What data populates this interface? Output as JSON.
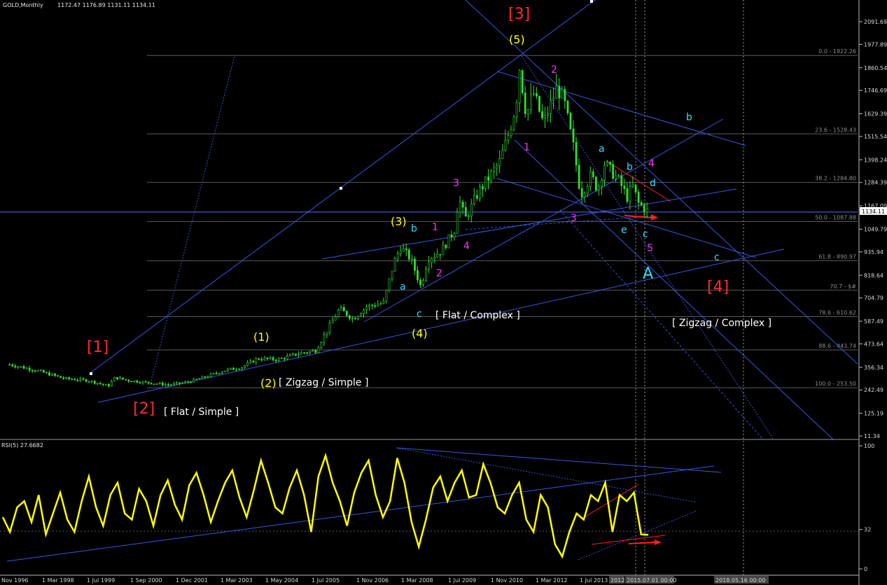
{
  "header": {
    "symbol": "GOLD,Monthly",
    "ohlc": "1172.47 1176.89 1131.11 1134.11"
  },
  "chart_data": [
    {
      "type": "candlestick",
      "title": "GOLD,Monthly",
      "ylim": [
        11.34,
        2150
      ],
      "y_ticks": [
        "2091.69",
        "1977.89",
        "1860.54",
        "1746.69",
        "1629.39",
        "1515.54",
        "1398.24",
        "1284.39",
        "1167.09",
        "1049.79",
        "935.94",
        "818.64",
        "704.79",
        "587.49",
        "473.64",
        "356.34",
        "242.49",
        "125.19",
        "11.34"
      ],
      "current_price_label": "1134.11",
      "x_tick_labels": [
        "Nov 1996",
        "1 Mar 1998",
        "1 Jul 1999",
        "1 Sep 2000",
        "1 Dec 2001",
        "1 Mar 2003",
        "1 May 2004",
        "1 Jul 2005",
        "1 Nov 2006",
        "1 Mar 2008",
        "1 Jul 2009",
        "1 Nov 2010",
        "1 Mar 2012",
        "1 Jul 2013",
        "2012",
        "2015.07.01 00:00",
        "2018.05.16 00:00"
      ],
      "price_path": [
        [
          1996.7,
          370
        ],
        [
          1997.5,
          340
        ],
        [
          1998.3,
          300
        ],
        [
          1999.0,
          290
        ],
        [
          1999.6,
          262
        ],
        [
          1999.8,
          305
        ],
        [
          2000.2,
          290
        ],
        [
          2000.8,
          278
        ],
        [
          2001.4,
          268
        ],
        [
          2001.9,
          280
        ],
        [
          2002.5,
          310
        ],
        [
          2003.0,
          340
        ],
        [
          2003.5,
          355
        ],
        [
          2004.0,
          400
        ],
        [
          2004.6,
          395
        ],
        [
          2005.2,
          425
        ],
        [
          2005.7,
          440
        ],
        [
          2006.1,
          560
        ],
        [
          2006.4,
          650
        ],
        [
          2006.8,
          600
        ],
        [
          2007.2,
          660
        ],
        [
          2007.7,
          680
        ],
        [
          2008.0,
          880
        ],
        [
          2008.2,
          960
        ],
        [
          2008.5,
          900
        ],
        [
          2008.8,
          760
        ],
        [
          2009.0,
          900
        ],
        [
          2009.4,
          940
        ],
        [
          2009.8,
          1050
        ],
        [
          2009.9,
          1210
        ],
        [
          2010.1,
          1100
        ],
        [
          2010.5,
          1240
        ],
        [
          2010.8,
          1310
        ],
        [
          2011.1,
          1380
        ],
        [
          2011.4,
          1540
        ],
        [
          2011.6,
          1680
        ],
        [
          2011.7,
          1860
        ],
        [
          2011.9,
          1620
        ],
        [
          2012.1,
          1740
        ],
        [
          2012.4,
          1580
        ],
        [
          2012.8,
          1760
        ],
        [
          2013.0,
          1700
        ],
        [
          2013.3,
          1450
        ],
        [
          2013.5,
          1220
        ],
        [
          2013.8,
          1320
        ],
        [
          2014.0,
          1250
        ],
        [
          2014.2,
          1380
        ],
        [
          2014.6,
          1300
        ],
        [
          2014.9,
          1200
        ],
        [
          2015.0,
          1280
        ],
        [
          2015.2,
          1180
        ],
        [
          2015.5,
          1134
        ]
      ],
      "fib_levels": [
        {
          "label": "0.0 - 1922.26",
          "value": 1922.26
        },
        {
          "label": "23.6 - 1528.43",
          "value": 1528.43
        },
        {
          "label": "38.2 - 1284.80",
          "value": 1284.8
        },
        {
          "label": "50.0 - 1087.88",
          "value": 1087.88
        },
        {
          "label": "61.8 - 890.97",
          "value": 890.97
        },
        {
          "label": "70.7 - $#",
          "value": 743
        },
        {
          "label": "78.6 - 610.62",
          "value": 610.62
        },
        {
          "label": "88.6 - 443.74",
          "value": 443.74
        },
        {
          "label": "100.0 - 253.50",
          "value": 253.5
        }
      ],
      "annotations": [
        {
          "text": "[1]",
          "color": "#ff2a2a"
        },
        {
          "text": "[2]",
          "color": "#ff2a2a"
        },
        {
          "text": "[3]",
          "color": "#ff2a2a"
        },
        {
          "text": "[4]",
          "color": "#ff2a2a"
        },
        {
          "text": "[ Flat / Simple ]",
          "color": "#ffffff"
        },
        {
          "text": "[ Zigzag / Simple ]",
          "color": "#ffffff"
        },
        {
          "text": "[ Flat / Complex ]",
          "color": "#ffffff"
        },
        {
          "text": "[ Zigzag / Complex ]",
          "color": "#ffffff"
        },
        {
          "text": "(1)",
          "color": "#ffff00"
        },
        {
          "text": "(2)",
          "color": "#ffff00"
        },
        {
          "text": "(3)",
          "color": "#ffff00"
        },
        {
          "text": "(4)",
          "color": "#ffff00"
        },
        {
          "text": "(5)",
          "color": "#ffff00"
        },
        {
          "text": "1",
          "color": "#ff33ff"
        },
        {
          "text": "2",
          "color": "#ff33ff"
        },
        {
          "text": "3",
          "color": "#ff33ff"
        },
        {
          "text": "4",
          "color": "#ff33ff"
        },
        {
          "text": "1",
          "color": "#ff33ff"
        },
        {
          "text": "2",
          "color": "#ff33ff"
        },
        {
          "text": "3",
          "color": "#ff33ff"
        },
        {
          "text": "4",
          "color": "#ff33ff"
        },
        {
          "text": "5",
          "color": "#ff33ff"
        },
        {
          "text": "a",
          "color": "#33ddff"
        },
        {
          "text": "b",
          "color": "#33ddff"
        },
        {
          "text": "c",
          "color": "#33ddff"
        },
        {
          "text": "a",
          "color": "#33ddff"
        },
        {
          "text": "b",
          "color": "#33ddff"
        },
        {
          "text": "c",
          "color": "#33ddff"
        },
        {
          "text": "d",
          "color": "#33ddff"
        },
        {
          "text": "e",
          "color": "#33ddff"
        },
        {
          "text": "b",
          "color": "#33ddff"
        },
        {
          "text": "c",
          "color": "#33ddff"
        },
        {
          "text": "A",
          "color": "#33ddff"
        }
      ]
    },
    {
      "type": "line",
      "title": "RSI(5) 27.6682",
      "ylim": [
        0,
        100
      ],
      "y_ticks": [
        "100",
        "32",
        "0"
      ],
      "series": [
        {
          "name": "RSI(5)",
          "color": "#ffff00",
          "values": [
            42,
            30,
            50,
            55,
            38,
            60,
            28,
            45,
            62,
            40,
            30,
            55,
            75,
            50,
            35,
            60,
            70,
            45,
            40,
            65,
            55,
            35,
            60,
            72,
            52,
            40,
            68,
            78,
            60,
            38,
            55,
            70,
            80,
            58,
            42,
            64,
            88,
            70,
            50,
            45,
            66,
            80,
            60,
            30,
            75,
            92,
            70,
            55,
            35,
            62,
            78,
            88,
            60,
            42,
            55,
            90,
            70,
            38,
            18,
            40,
            66,
            75,
            55,
            70,
            80,
            58,
            60,
            85,
            70,
            50,
            45,
            60,
            70,
            40,
            30,
            60,
            50,
            20,
            10,
            30,
            45,
            40,
            60,
            55,
            70,
            30,
            60,
            55,
            62,
            28,
            27.67
          ]
        }
      ]
    }
  ]
}
